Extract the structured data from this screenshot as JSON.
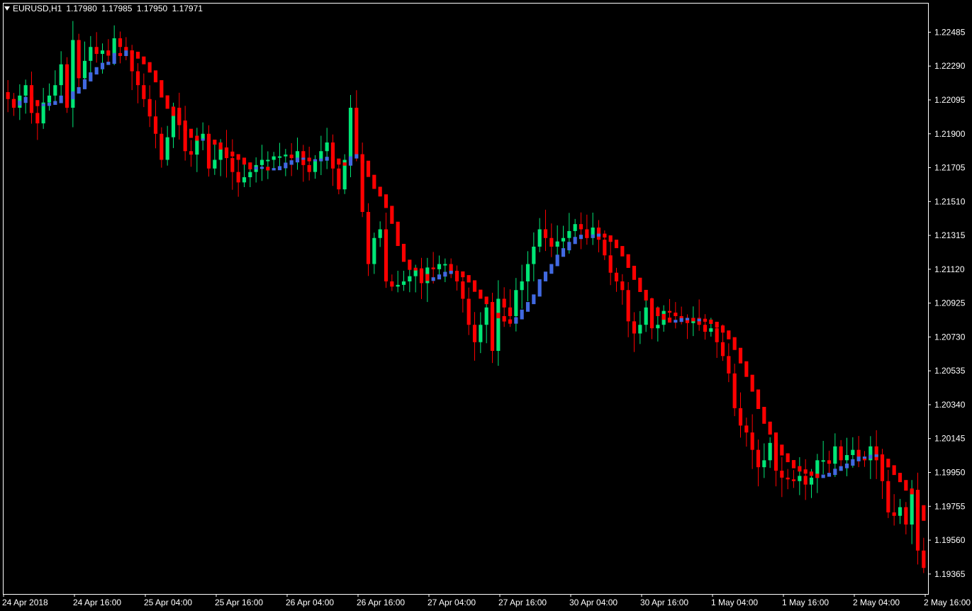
{
  "header": {
    "symbol": "EURUSD,H1",
    "open": "1.17980",
    "high": "1.17985",
    "low": "1.17950",
    "close": "1.17971"
  },
  "colors": {
    "background": "#000000",
    "frame": "#ffffff",
    "bull": "#00e676",
    "bear": "#ff0000",
    "ma_up": "#4169e1",
    "ma_down": "#ff0000",
    "text": "#ffffff"
  },
  "chart_data": {
    "type": "candlestick",
    "symbol": "EURUSD",
    "timeframe": "H1",
    "ylim": [
      1.1925,
      1.2265
    ],
    "yticks": [
      "1.22485",
      "1.22290",
      "1.22095",
      "1.21900",
      "1.21705",
      "1.21510",
      "1.21315",
      "1.21120",
      "1.20925",
      "1.20730",
      "1.20535",
      "1.20340",
      "1.20145",
      "1.19950",
      "1.19755",
      "1.19560",
      "1.19365"
    ],
    "xticks": [
      "24 Apr 2018",
      "24 Apr 16:00",
      "25 Apr 04:00",
      "25 Apr 16:00",
      "26 Apr 04:00",
      "26 Apr 16:00",
      "27 Apr 04:00",
      "27 Apr 16:00",
      "30 Apr 04:00",
      "30 Apr 16:00",
      "1 May 04:00",
      "1 May 16:00",
      "2 May 04:00",
      "2 May 16:00"
    ],
    "close_series": [
      1.221,
      1.2205,
      1.2212,
      1.2218,
      1.2202,
      1.2196,
      1.2208,
      1.2212,
      1.2218,
      1.223,
      1.2205,
      1.2244,
      1.2222,
      1.2232,
      1.224,
      1.2236,
      1.2238,
      1.2235,
      1.2245,
      1.224,
      1.2238,
      1.2226,
      1.2218,
      1.221,
      1.22,
      1.219,
      1.2175,
      1.2188,
      1.2205,
      1.2195,
      1.218,
      1.2178,
      1.2187,
      1.219,
      1.217,
      1.2175,
      1.2182,
      1.2176,
      1.2168,
      1.2162,
      1.2165,
      1.2168,
      1.2172,
      1.2175,
      1.2175,
      1.2177,
      1.2177,
      1.2178,
      1.2176,
      1.218,
      1.2172,
      1.2168,
      1.2175,
      1.218,
      1.2185,
      1.217,
      1.2158,
      1.2175,
      1.2205,
      1.2178,
      1.2145,
      1.2115,
      1.213,
      1.2135,
      1.2105,
      1.2102,
      1.2103,
      1.2105,
      1.2108,
      1.2112,
      1.2104,
      1.2113,
      1.2112,
      1.2115,
      1.2115,
      1.211,
      1.2105,
      1.2095,
      1.208,
      1.207,
      1.208,
      1.209,
      1.2065,
      1.2095,
      1.209,
      1.2085,
      1.21,
      1.2105,
      1.2115,
      1.2125,
      1.2135,
      1.213,
      1.2125,
      1.2128,
      1.213,
      1.2134,
      1.2138,
      1.2135,
      1.213,
      1.2136,
      1.2129,
      1.212,
      1.211,
      1.2105,
      1.21,
      1.2082,
      1.2075,
      1.208,
      1.209,
      1.2078,
      1.208,
      1.2088,
      1.2087,
      1.2085,
      1.2083,
      1.2081,
      1.2084,
      1.208,
      1.2076,
      1.2078,
      1.207,
      1.2062,
      1.2052,
      1.2032,
      1.2022,
      1.2018,
      1.2008,
      1.1998,
      1.2002,
      1.2012,
      1.1996,
      1.1992,
      1.1991,
      1.199,
      1.1993,
      1.1988,
      1.1992,
      1.2002,
      1.2002,
      1.2,
      1.201,
      1.2002,
      1.2005,
      1.2008,
      1.2004,
      1.2002,
      1.201,
      1.2002,
      1.199,
      1.1972,
      1.197,
      1.1975,
      1.1965,
      1.1985,
      1.195,
      1.194
    ]
  }
}
